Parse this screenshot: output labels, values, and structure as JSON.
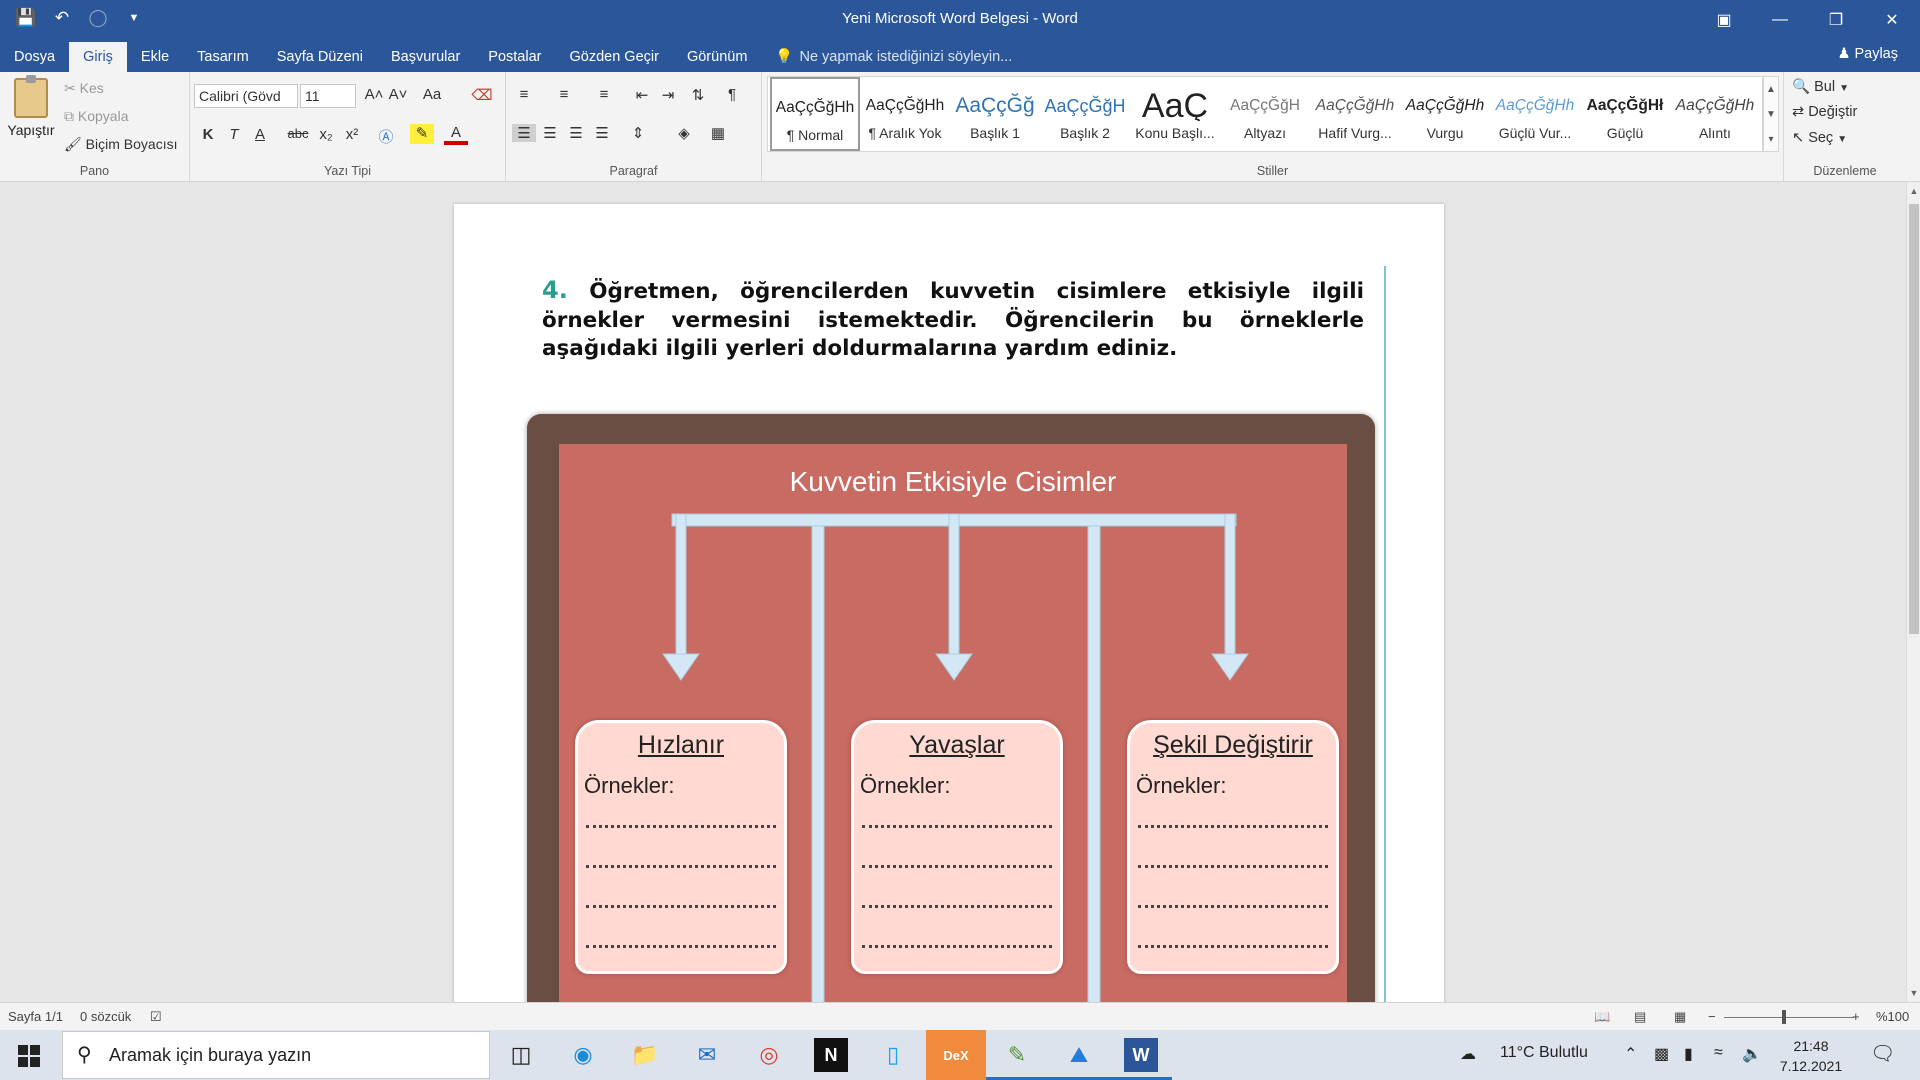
{
  "window": {
    "title": "Yeni Microsoft Word Belgesi - Word"
  },
  "qat": {
    "save": "save-icon",
    "undo": "undo-icon",
    "redo": "redo-icon",
    "customize": "customize-icon"
  },
  "tabs": [
    "Dosya",
    "Giriş",
    "Ekle",
    "Tasarım",
    "Sayfa Düzeni",
    "Başvurular",
    "Postalar",
    "Gözden Geçir",
    "Görünüm"
  ],
  "tellme": "Ne yapmak istediğinizi söyleyin...",
  "share": "Paylaş",
  "ribbon": {
    "clipboard": {
      "paste": "Yapıştır",
      "cut": "Kes",
      "copy": "Kopyala",
      "format_painter": "Biçim Boyacısı",
      "label": "Pano"
    },
    "font": {
      "name": "Calibri (Gövd",
      "size": "11",
      "label": "Yazı Tipi",
      "case": "Aa",
      "bold": "K",
      "italic": "T",
      "underline": "A",
      "strike": "abc",
      "sub": "x₂",
      "sup": "x²",
      "grow": "A˄",
      "shrink": "A˅"
    },
    "paragraph": {
      "label": "Paragraf"
    },
    "styles": {
      "label": "Stiller",
      "items": [
        {
          "preview": "AaÇçĞğHh",
          "name": "¶ Normal"
        },
        {
          "preview": "AaÇçĞğHh",
          "name": "¶ Aralık Yok"
        },
        {
          "preview": "AaÇçĞğ",
          "name": "Başlık 1"
        },
        {
          "preview": "AaÇçĞğH",
          "name": "Başlık 2"
        },
        {
          "preview": "AaÇ",
          "name": "Konu Başlı..."
        },
        {
          "preview": "AaÇçĞğH",
          "name": "Altyazı"
        },
        {
          "preview": "AaÇçĞğHh",
          "name": "Hafif Vurg..."
        },
        {
          "preview": "AaÇçĞğHh",
          "name": "Vurgu"
        },
        {
          "preview": "AaÇçĞğHh",
          "name": "Güçlü Vur..."
        },
        {
          "preview": "AaÇçĞğHł",
          "name": "Güçlü"
        },
        {
          "preview": "AaÇçĞğHh",
          "name": "Alıntı"
        }
      ]
    },
    "editing": {
      "find": "Bul",
      "replace": "Değiştir",
      "select": "Seç",
      "label": "Düzenleme"
    }
  },
  "document": {
    "question_number": "4.",
    "question_text": "Öğretmen, öğrencilerden kuvvetin cisimlere etkisiyle ilgili örnekler vermesini istemektedir. Öğrencilerin bu örneklerle aşağıdaki ilgili yerleri doldurmalarına yardım ediniz.",
    "chart_title": "Kuvvetin Etkisiyle Cisimler",
    "cards": [
      {
        "title": "Hızlanır",
        "subtitle": "Örnekler:"
      },
      {
        "title": "Yavaşlar",
        "subtitle": "Örnekler:"
      },
      {
        "title": "Şekil Değiştirir",
        "subtitle": "Örnekler:"
      }
    ]
  },
  "status": {
    "page": "Sayfa 1/1",
    "words": "0 sözcük",
    "zoom": "%100",
    "zoom_minus": "−",
    "zoom_plus": "+"
  },
  "taskbar": {
    "search_placeholder": "Aramak için buraya yazın",
    "weather": "11°C  Bulutlu",
    "time": "21:48",
    "date": "7.12.2021"
  },
  "colors": {
    "word_blue": "#2b579a",
    "board_frame": "#6b4e43",
    "board_fill": "#c86b63",
    "card_fill": "#ffd9d2",
    "arrow": "#d3e8f4",
    "question_number": "#2a9d8f"
  }
}
